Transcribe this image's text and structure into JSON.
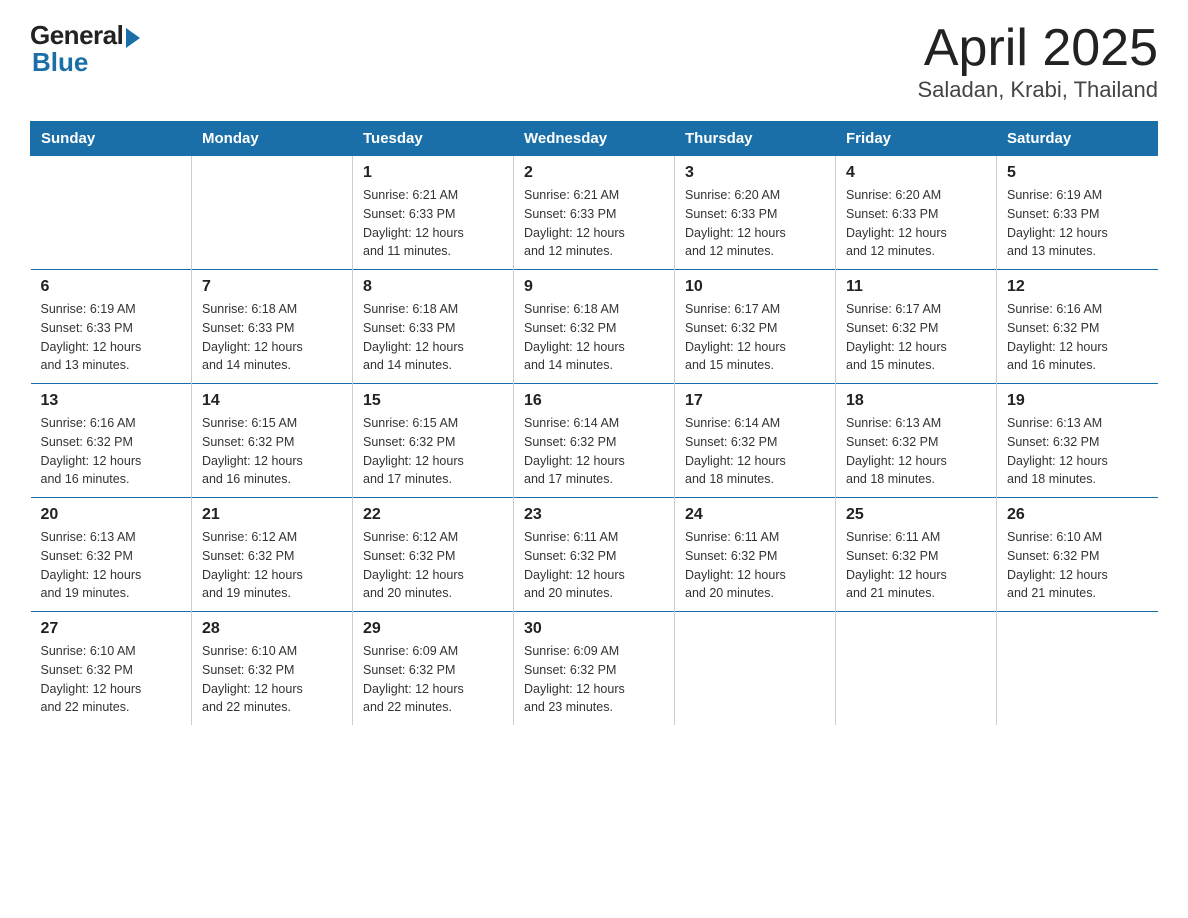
{
  "logo": {
    "general": "General",
    "blue": "Blue"
  },
  "title": "April 2025",
  "subtitle": "Saladan, Krabi, Thailand",
  "header": {
    "days": [
      "Sunday",
      "Monday",
      "Tuesday",
      "Wednesday",
      "Thursday",
      "Friday",
      "Saturday"
    ]
  },
  "weeks": [
    [
      {
        "day": "",
        "detail": ""
      },
      {
        "day": "",
        "detail": ""
      },
      {
        "day": "1",
        "detail": "Sunrise: 6:21 AM\nSunset: 6:33 PM\nDaylight: 12 hours\nand 11 minutes."
      },
      {
        "day": "2",
        "detail": "Sunrise: 6:21 AM\nSunset: 6:33 PM\nDaylight: 12 hours\nand 12 minutes."
      },
      {
        "day": "3",
        "detail": "Sunrise: 6:20 AM\nSunset: 6:33 PM\nDaylight: 12 hours\nand 12 minutes."
      },
      {
        "day": "4",
        "detail": "Sunrise: 6:20 AM\nSunset: 6:33 PM\nDaylight: 12 hours\nand 12 minutes."
      },
      {
        "day": "5",
        "detail": "Sunrise: 6:19 AM\nSunset: 6:33 PM\nDaylight: 12 hours\nand 13 minutes."
      }
    ],
    [
      {
        "day": "6",
        "detail": "Sunrise: 6:19 AM\nSunset: 6:33 PM\nDaylight: 12 hours\nand 13 minutes."
      },
      {
        "day": "7",
        "detail": "Sunrise: 6:18 AM\nSunset: 6:33 PM\nDaylight: 12 hours\nand 14 minutes."
      },
      {
        "day": "8",
        "detail": "Sunrise: 6:18 AM\nSunset: 6:33 PM\nDaylight: 12 hours\nand 14 minutes."
      },
      {
        "day": "9",
        "detail": "Sunrise: 6:18 AM\nSunset: 6:32 PM\nDaylight: 12 hours\nand 14 minutes."
      },
      {
        "day": "10",
        "detail": "Sunrise: 6:17 AM\nSunset: 6:32 PM\nDaylight: 12 hours\nand 15 minutes."
      },
      {
        "day": "11",
        "detail": "Sunrise: 6:17 AM\nSunset: 6:32 PM\nDaylight: 12 hours\nand 15 minutes."
      },
      {
        "day": "12",
        "detail": "Sunrise: 6:16 AM\nSunset: 6:32 PM\nDaylight: 12 hours\nand 16 minutes."
      }
    ],
    [
      {
        "day": "13",
        "detail": "Sunrise: 6:16 AM\nSunset: 6:32 PM\nDaylight: 12 hours\nand 16 minutes."
      },
      {
        "day": "14",
        "detail": "Sunrise: 6:15 AM\nSunset: 6:32 PM\nDaylight: 12 hours\nand 16 minutes."
      },
      {
        "day": "15",
        "detail": "Sunrise: 6:15 AM\nSunset: 6:32 PM\nDaylight: 12 hours\nand 17 minutes."
      },
      {
        "day": "16",
        "detail": "Sunrise: 6:14 AM\nSunset: 6:32 PM\nDaylight: 12 hours\nand 17 minutes."
      },
      {
        "day": "17",
        "detail": "Sunrise: 6:14 AM\nSunset: 6:32 PM\nDaylight: 12 hours\nand 18 minutes."
      },
      {
        "day": "18",
        "detail": "Sunrise: 6:13 AM\nSunset: 6:32 PM\nDaylight: 12 hours\nand 18 minutes."
      },
      {
        "day": "19",
        "detail": "Sunrise: 6:13 AM\nSunset: 6:32 PM\nDaylight: 12 hours\nand 18 minutes."
      }
    ],
    [
      {
        "day": "20",
        "detail": "Sunrise: 6:13 AM\nSunset: 6:32 PM\nDaylight: 12 hours\nand 19 minutes."
      },
      {
        "day": "21",
        "detail": "Sunrise: 6:12 AM\nSunset: 6:32 PM\nDaylight: 12 hours\nand 19 minutes."
      },
      {
        "day": "22",
        "detail": "Sunrise: 6:12 AM\nSunset: 6:32 PM\nDaylight: 12 hours\nand 20 minutes."
      },
      {
        "day": "23",
        "detail": "Sunrise: 6:11 AM\nSunset: 6:32 PM\nDaylight: 12 hours\nand 20 minutes."
      },
      {
        "day": "24",
        "detail": "Sunrise: 6:11 AM\nSunset: 6:32 PM\nDaylight: 12 hours\nand 20 minutes."
      },
      {
        "day": "25",
        "detail": "Sunrise: 6:11 AM\nSunset: 6:32 PM\nDaylight: 12 hours\nand 21 minutes."
      },
      {
        "day": "26",
        "detail": "Sunrise: 6:10 AM\nSunset: 6:32 PM\nDaylight: 12 hours\nand 21 minutes."
      }
    ],
    [
      {
        "day": "27",
        "detail": "Sunrise: 6:10 AM\nSunset: 6:32 PM\nDaylight: 12 hours\nand 22 minutes."
      },
      {
        "day": "28",
        "detail": "Sunrise: 6:10 AM\nSunset: 6:32 PM\nDaylight: 12 hours\nand 22 minutes."
      },
      {
        "day": "29",
        "detail": "Sunrise: 6:09 AM\nSunset: 6:32 PM\nDaylight: 12 hours\nand 22 minutes."
      },
      {
        "day": "30",
        "detail": "Sunrise: 6:09 AM\nSunset: 6:32 PM\nDaylight: 12 hours\nand 23 minutes."
      },
      {
        "day": "",
        "detail": ""
      },
      {
        "day": "",
        "detail": ""
      },
      {
        "day": "",
        "detail": ""
      }
    ]
  ]
}
